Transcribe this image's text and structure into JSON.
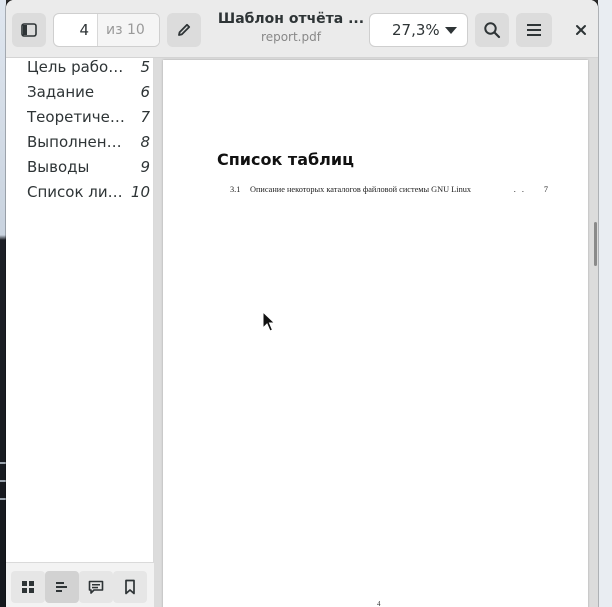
{
  "window": {
    "title": "Шаблон отчёта ...",
    "subtitle": "report.pdf"
  },
  "toolbar": {
    "sidebar_toggle_icon": "sidebar-icon",
    "page_current": "4",
    "page_total": "из 10",
    "annotate_icon": "pencil-icon",
    "zoom": "27,3%",
    "search_icon": "search-icon",
    "menu_icon": "hamburger-icon",
    "close_icon": "close-icon"
  },
  "sidebar": {
    "items": [
      {
        "label": "Цель работы",
        "page": "5"
      },
      {
        "label": "Задание",
        "page": "6"
      },
      {
        "label": "Теоретическое введение",
        "page": "7"
      },
      {
        "label": "Выполнение лабораторной работы",
        "page": "8"
      },
      {
        "label": "Выводы",
        "page": "9"
      },
      {
        "label": "Список литературы",
        "page": "10"
      }
    ],
    "bottom_buttons": [
      "thumbnails-icon",
      "outline-icon",
      "annotations-icon",
      "bookmarks-icon"
    ]
  },
  "document": {
    "heading": "Список таблиц",
    "entries": [
      {
        "number": "3.1",
        "text": "Описание некоторых каталогов файловой системы GNU Linux",
        "dots": ". .",
        "page": "7"
      }
    ],
    "footer_page": "4"
  },
  "colors": {
    "headerbar": "#ebebeb",
    "sidebar": "#ffffff",
    "doc_background": "#dcdcdc",
    "desktop_accent": "#3f8be8"
  }
}
